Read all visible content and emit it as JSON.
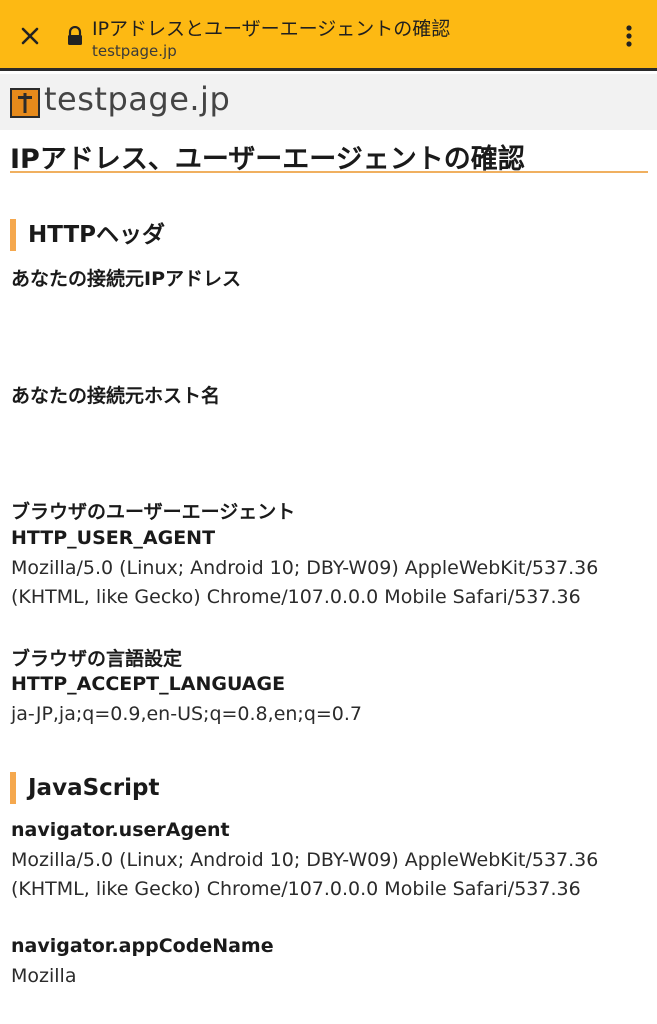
{
  "browser": {
    "tab_title": "IPアドレスとユーザーエージェントの確認",
    "url": "testpage.jp"
  },
  "site": {
    "name": "testpage.jp"
  },
  "page": {
    "title": "IPアドレス、ユーザーエージェントの確認"
  },
  "http_section": {
    "heading": "HTTPヘッダ",
    "ip_label": "あなたの接続元IPアドレス",
    "ip_value": "",
    "host_label": "あなたの接続元ホスト名",
    "host_value": "",
    "ua_label": "ブラウザのユーザーエージェント",
    "ua_key": "HTTP_USER_AGENT",
    "ua_value": "Mozilla/5.0 (Linux; Android 10; DBY-W09) AppleWebKit/537.36 (KHTML, like Gecko) Chrome/107.0.0.0 Mobile Safari/537.36",
    "lang_label": "ブラウザの言語設定",
    "lang_key": "HTTP_ACCEPT_LANGUAGE",
    "lang_value": "ja-JP,ja;q=0.9,en-US;q=0.8,en;q=0.7"
  },
  "js_section": {
    "heading": "JavaScript",
    "ua_key": "navigator.userAgent",
    "ua_value": "Mozilla/5.0 (Linux; Android 10; DBY-W09) AppleWebKit/537.36 (KHTML, like Gecko) Chrome/107.0.0.0 Mobile Safari/537.36",
    "codename_key": "navigator.appCodeName",
    "codename_value": "Mozilla"
  },
  "colors": {
    "toolbar": "#fdb913",
    "accent": "#f5a84e",
    "logo": "#e68a1b"
  },
  "icons": {
    "close": "close-icon",
    "lock": "lock-icon",
    "menu": "more-vertical-icon"
  }
}
